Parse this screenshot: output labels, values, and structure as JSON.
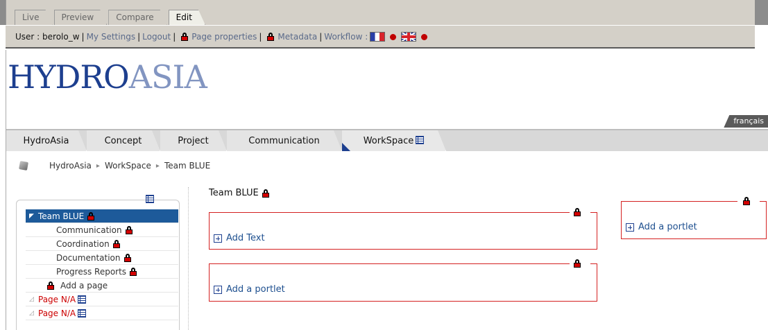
{
  "mode_tabs": [
    {
      "label": "Live"
    },
    {
      "label": "Preview"
    },
    {
      "label": "Compare"
    },
    {
      "label": "Edit",
      "active": true
    }
  ],
  "userbar": {
    "user": "User : berolo_w",
    "my_settings": "My Settings",
    "logout": "Logout",
    "page_properties": "Page properties",
    "metadata": "Metadata",
    "workflow": "Workflow :",
    "sep": "|"
  },
  "logo": {
    "part1": "HYDRO",
    "part2": "ASIA"
  },
  "language_tab": "français",
  "nav_tabs": [
    {
      "label": "HydroAsia"
    },
    {
      "label": "Concept"
    },
    {
      "label": "Project"
    },
    {
      "label": "Communication"
    },
    {
      "label": "WorkSpace",
      "active": true
    }
  ],
  "breadcrumb": {
    "items": [
      "HydroAsia",
      "WorkSpace",
      "Team BLUE"
    ],
    "sep": "▸"
  },
  "tree": {
    "selected": "Team BLUE",
    "children": [
      "Communication",
      "Coordination",
      "Documentation",
      "Progress Reports"
    ],
    "add_page": "Add a page",
    "na_items": [
      "Page N/A",
      "Page N/A"
    ]
  },
  "content": {
    "title": "Team BLUE",
    "add_text": "Add Text",
    "add_portlet": "Add a portlet",
    "add_portlet_right": "Add a portlet"
  },
  "colors": {
    "brand": "#1d3f8f",
    "lock": "#d40000",
    "portlet_border": "#d42020",
    "selected": "#1d5a9a"
  }
}
